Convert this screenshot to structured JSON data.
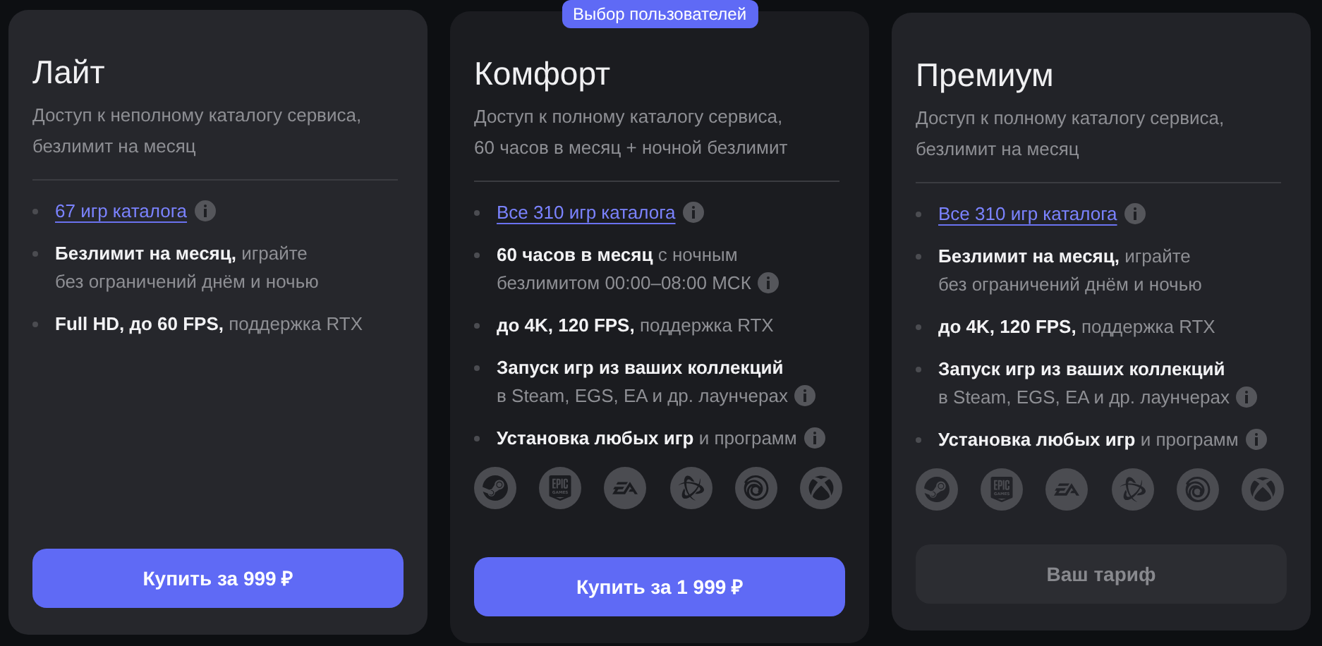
{
  "plans": [
    {
      "name": "Лайт",
      "description": [
        "Доступ к неполному каталогу сервиса,",
        "безлимит на месяц"
      ],
      "show_launchers": false,
      "current": false,
      "button": "Купить за 999 ₽",
      "features": [
        {
          "kind": "link",
          "lines": [
            "67 игр каталога"
          ],
          "info": true
        },
        {
          "kind": "text",
          "lines": [
            "**Безлимит на месяц,** играйте",
            "без ограничений днём и ночью"
          ],
          "info": false
        },
        {
          "kind": "text",
          "lines": [
            "**Full HD, до 60 FPS,** поддержка RTX"
          ],
          "info": false
        }
      ]
    },
    {
      "name": "Комфорт",
      "badge": "Выбор пользователей",
      "description": [
        "Доступ к полному каталогу сервиса,",
        "60 часов в месяц + ночной безлимит"
      ],
      "show_launchers": true,
      "current": false,
      "button": "Купить за 1 999 ₽",
      "features": [
        {
          "kind": "link",
          "lines": [
            "Все 310 игр каталога"
          ],
          "info": true
        },
        {
          "kind": "text",
          "lines": [
            "**60 часов в месяц** с ночным",
            "безлимитом 00:00–08:00 МСК"
          ],
          "info": true
        },
        {
          "kind": "text",
          "lines": [
            "**до 4K, 120 FPS,** поддержка RTX"
          ],
          "info": false
        },
        {
          "kind": "text",
          "lines": [
            "**Запуск игр из ваших коллекций**",
            "в Steam, EGS, EA и др. лаунчерах"
          ],
          "info": true
        },
        {
          "kind": "text",
          "lines": [
            "**Установка любых игр** и программ"
          ],
          "info": true
        }
      ]
    },
    {
      "name": "Премиум",
      "description": [
        "Доступ к полному каталогу сервиса,",
        "безлимит на месяц"
      ],
      "show_launchers": true,
      "current": true,
      "button": "Ваш тариф",
      "features": [
        {
          "kind": "link",
          "lines": [
            "Все 310 игр каталога"
          ],
          "info": true
        },
        {
          "kind": "text",
          "lines": [
            "**Безлимит на месяц,** играйте",
            "без ограничений днём и ночью"
          ],
          "info": false
        },
        {
          "kind": "text",
          "lines": [
            "**до 4K, 120 FPS,** поддержка RTX"
          ],
          "info": false
        },
        {
          "kind": "text",
          "lines": [
            "**Запуск игр из ваших коллекций**",
            "в Steam, EGS, EA и др. лаунчерах"
          ],
          "info": true
        },
        {
          "kind": "text",
          "lines": [
            "**Установка любых игр** и программ"
          ],
          "info": true
        }
      ]
    }
  ]
}
